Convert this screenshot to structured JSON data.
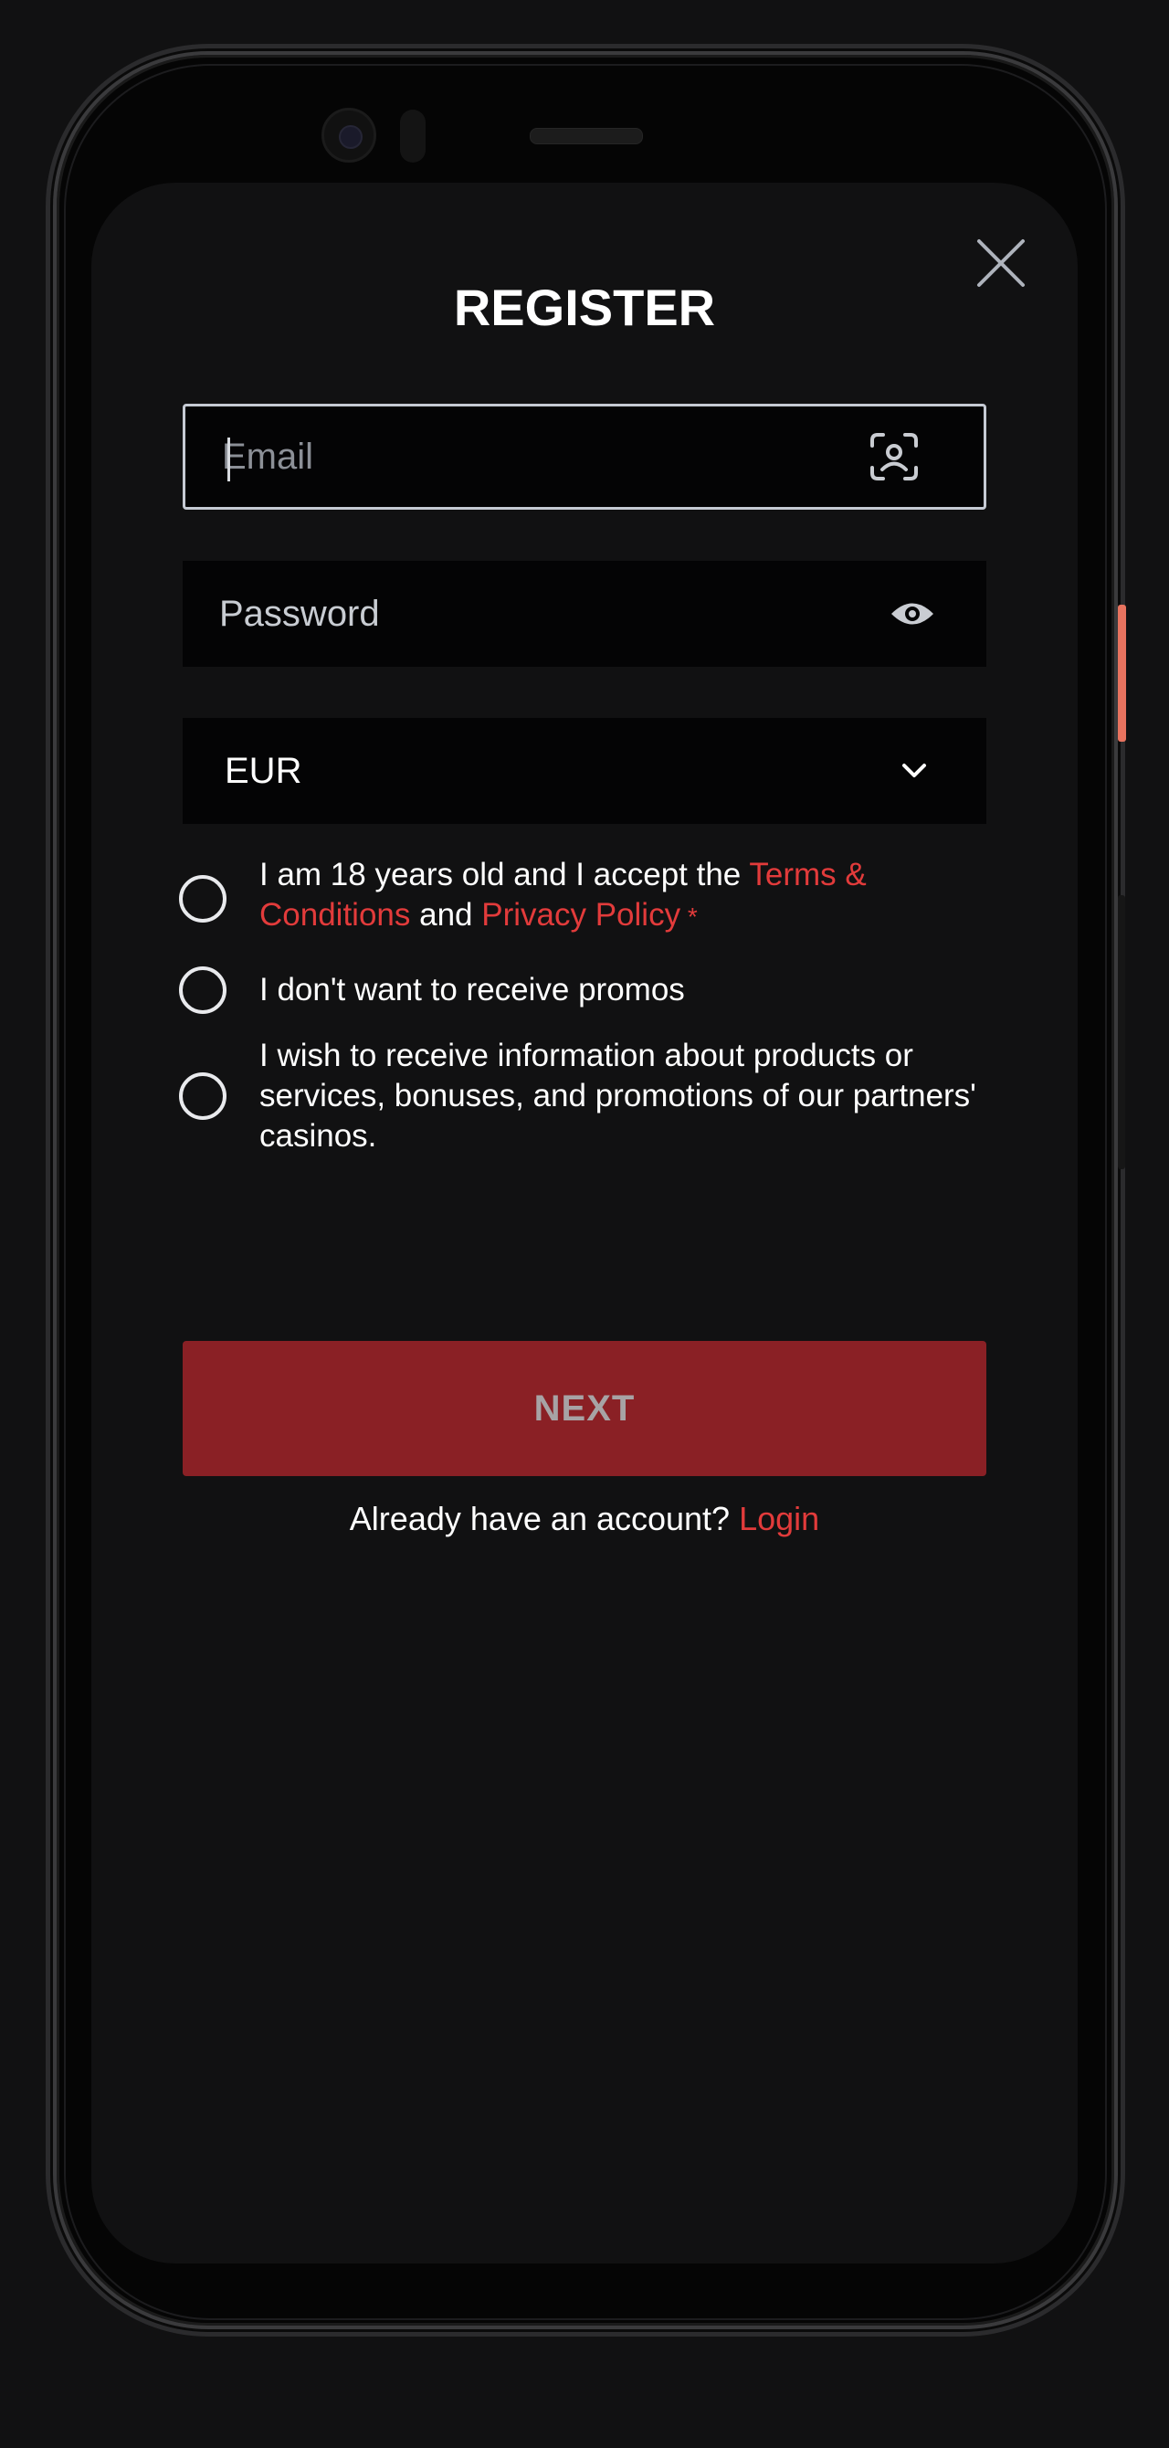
{
  "modal": {
    "title": "REGISTER"
  },
  "form": {
    "email_placeholder": "Email",
    "password_placeholder": "Password",
    "currency_value": "EUR"
  },
  "checkboxes": {
    "terms_prefix": "I am 18 years old and I accept the ",
    "terms_link": "Terms & Conditions",
    "terms_and": " and ",
    "privacy_link": "Privacy Policy",
    "required_mark": " *",
    "no_promos": "I don't want to receive promos",
    "partners_info": "I wish to receive information about products or services, bonuses, and promotions of our partners' casinos."
  },
  "actions": {
    "next_label": "NEXT",
    "have_account": "Already have an account?",
    "login_label": "Login"
  },
  "colors": {
    "accent_red": "#e23b3b",
    "button_bg": "#8a2025",
    "background": "#111112",
    "field_bg": "#040405"
  },
  "icons": {
    "close": "close-icon",
    "email_field": "face-id-icon",
    "password_field": "eye-icon",
    "currency_field": "chevron-down-icon"
  }
}
